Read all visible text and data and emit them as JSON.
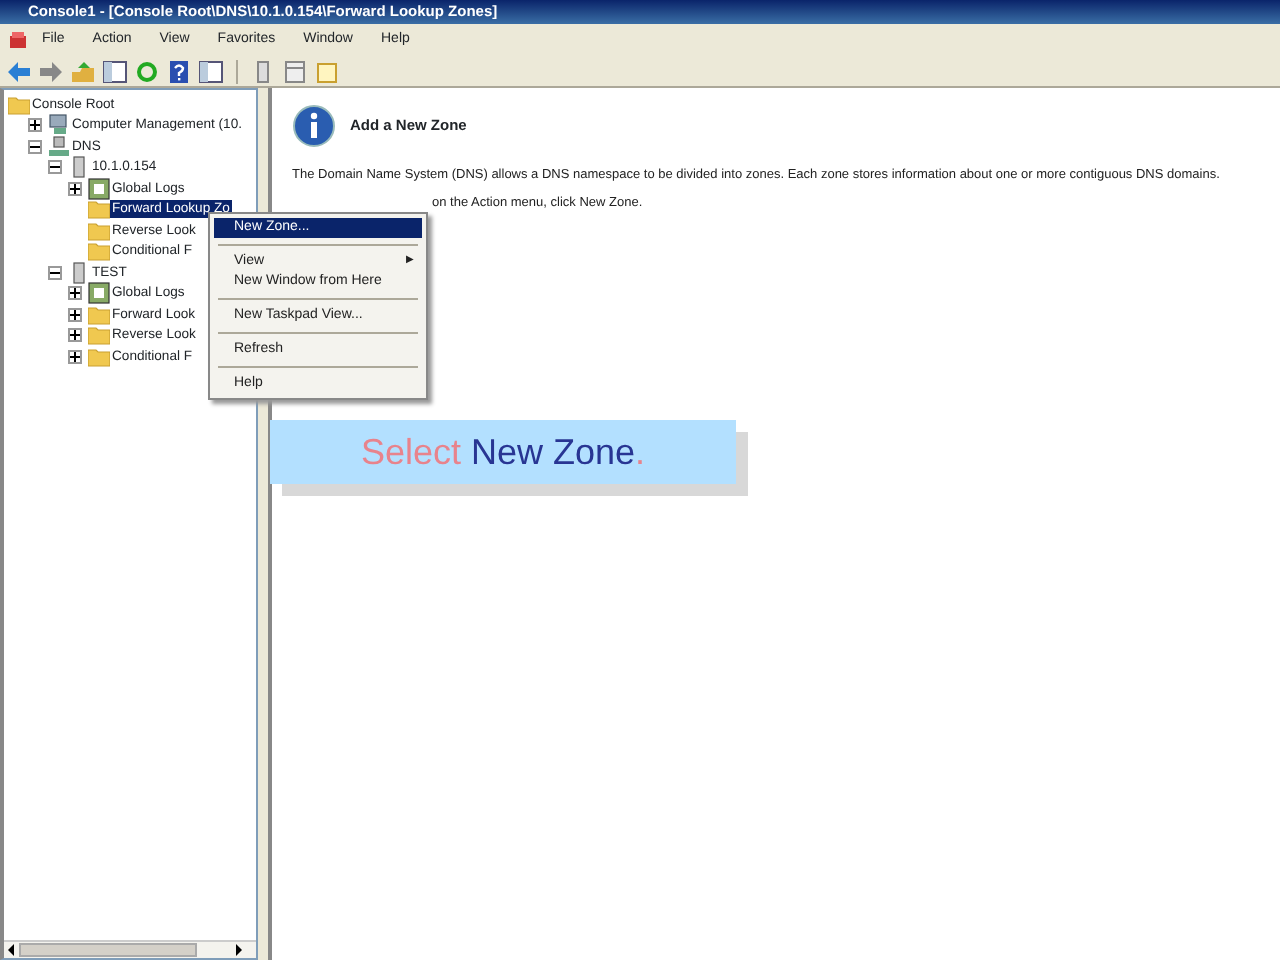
{
  "window": {
    "title": "Console1 - [Console Root\\DNS\\10.1.0.154\\Forward Lookup Zones]"
  },
  "menu_bar": [
    "File",
    "Action",
    "View",
    "Favorites",
    "Window",
    "Help"
  ],
  "toolbar": [
    {
      "kind": "back"
    },
    {
      "kind": "forward"
    },
    {
      "kind": "up"
    },
    {
      "kind": "pane"
    },
    {
      "kind": "refresh"
    },
    {
      "kind": "help"
    },
    {
      "kind": "pane"
    },
    {
      "kind": "sep"
    },
    {
      "kind": "column"
    },
    {
      "kind": "list"
    },
    {
      "kind": "note"
    }
  ],
  "tree": [
    {
      "label": "Console Root",
      "kind": "folder",
      "selected": false,
      "children": [
        {
          "label": "Computer Management (10.",
          "kind": "computer",
          "expanded": false,
          "selected": false
        },
        {
          "label": "DNS",
          "kind": "dns",
          "expanded": true,
          "selected": false,
          "children": [
            {
              "label": "10.1.0.154",
              "kind": "server",
              "expanded": true,
              "selected": false,
              "children": [
                {
                  "label": "Global Logs",
                  "kind": "logs",
                  "expanded": false,
                  "selected": false
                },
                {
                  "label": "Forward Lookup Zo",
                  "kind": "folder",
                  "selected": true
                },
                {
                  "label": "Reverse Look",
                  "kind": "folder",
                  "selected": false
                },
                {
                  "label": "Conditional F",
                  "kind": "folder",
                  "selected": false
                }
              ]
            },
            {
              "label": "TEST",
              "kind": "server",
              "expanded": true,
              "selected": false,
              "children": [
                {
                  "label": "Global Logs",
                  "kind": "logs",
                  "expanded": false,
                  "selected": false
                },
                {
                  "label": "Forward Look",
                  "kind": "folder",
                  "expanded": false,
                  "selected": false
                },
                {
                  "label": "Reverse Look",
                  "kind": "folder",
                  "expanded": false,
                  "selected": false
                },
                {
                  "label": "Conditional F",
                  "kind": "folder",
                  "expanded": false,
                  "selected": false
                }
              ]
            }
          ]
        }
      ]
    }
  ],
  "info": {
    "title": "Add a New Zone",
    "text": "The Domain Name System (DNS) allows a DNS namespace to be divided into zones. Each zone stores information about one or more contiguous DNS domains.",
    "hint": "on the Action menu, click New Zone."
  },
  "context_menu": [
    {
      "kind": "item",
      "label": "New Zone...",
      "selected": true
    },
    {
      "kind": "sep"
    },
    {
      "kind": "submenu",
      "label": "View",
      "selected": false,
      "arrow": "▶"
    },
    {
      "kind": "item",
      "label": "New Window from Here",
      "selected": false
    },
    {
      "kind": "sep"
    },
    {
      "kind": "item",
      "label": "New Taskpad View...",
      "selected": false
    },
    {
      "kind": "sep"
    },
    {
      "kind": "item",
      "label": "Refresh",
      "selected": false
    },
    {
      "kind": "sep"
    },
    {
      "kind": "item",
      "label": "Help",
      "selected": false
    }
  ],
  "caption": [
    {
      "text": "Select",
      "color": "#e8838c"
    },
    {
      "text": "New Zone",
      "color": "#283593"
    },
    {
      "text": ".",
      "color": "#e8838c"
    }
  ]
}
